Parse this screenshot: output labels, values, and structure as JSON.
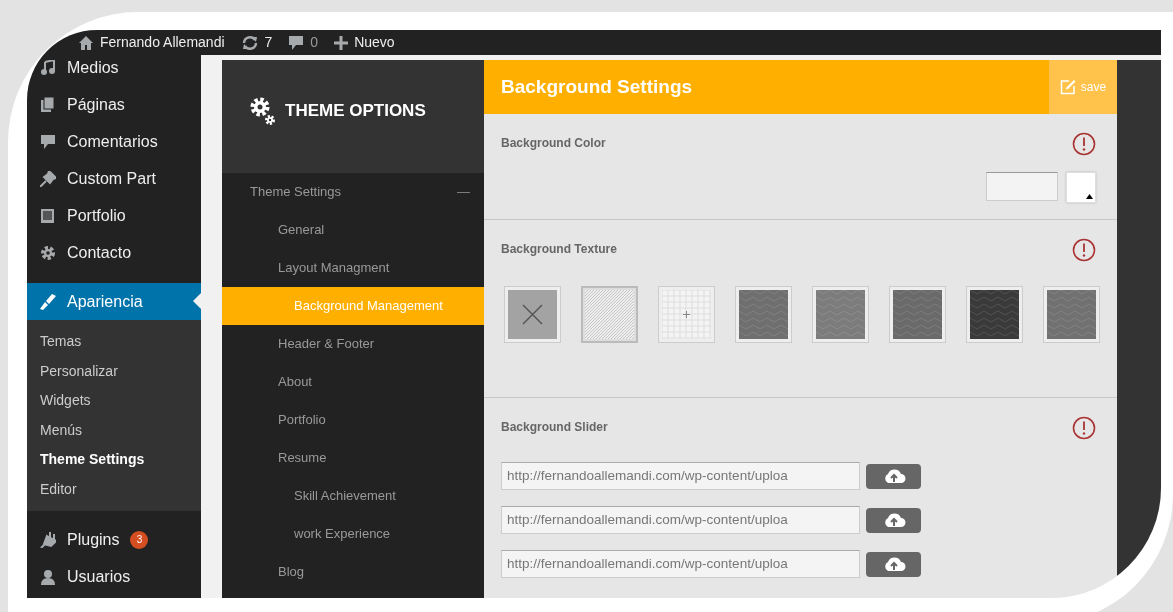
{
  "admin_bar": {
    "site": "Fernando Allemandi",
    "updates": "7",
    "comments": "0",
    "new": "Nuevo"
  },
  "admin_menu": [
    {
      "label": "Medios",
      "selected": false
    },
    {
      "label": "Páginas",
      "selected": false
    },
    {
      "label": "Comentarios",
      "selected": false
    },
    {
      "label": "Custom Part",
      "selected": false
    },
    {
      "label": "Portfolio",
      "selected": false
    },
    {
      "label": "Contacto",
      "selected": false
    },
    {
      "label": "Apariencia",
      "selected": true,
      "submenu": [
        {
          "label": "Temas",
          "selected": false
        },
        {
          "label": "Personalizar",
          "selected": false
        },
        {
          "label": "Widgets",
          "selected": false
        },
        {
          "label": "Menús",
          "selected": false
        },
        {
          "label": "Theme Settings",
          "selected": true
        },
        {
          "label": "Editor",
          "selected": false
        }
      ]
    },
    {
      "label": "Plugins",
      "selected": false,
      "badge": "3"
    },
    {
      "label": "Usuarios",
      "selected": false
    }
  ],
  "theme_panel": {
    "title": "THEME OPTIONS",
    "nav": [
      {
        "label": "Theme Settings",
        "selected": false,
        "expanded": true,
        "toggle": "—",
        "children": [
          {
            "label": "General",
            "selected": false
          },
          {
            "label": "Layout Managment",
            "selected": false
          },
          {
            "label": "Background Management",
            "selected": true
          },
          {
            "label": "Header & Footer",
            "selected": false
          },
          {
            "label": "About",
            "selected": false
          },
          {
            "label": "Portfolio",
            "selected": false
          },
          {
            "label": "Resume",
            "selected": false,
            "children": [
              {
                "label": "Skill Achievement",
                "selected": false
              },
              {
                "label": "work Experience",
                "selected": false
              }
            ]
          },
          {
            "label": "Blog",
            "selected": false
          }
        ]
      }
    ]
  },
  "settings": {
    "title": "Background Settings",
    "save": "save",
    "sections": [
      {
        "kind": "color",
        "label": "Background Color"
      },
      {
        "kind": "texture",
        "label": "Background Texture",
        "textures": [
          {
            "kind": "none",
            "selected": false
          },
          {
            "kind": "diagonal",
            "selected": true
          },
          {
            "kind": "grid",
            "selected": false
          },
          {
            "kind": "pattern",
            "color": "#6f6f6f",
            "selected": false
          },
          {
            "kind": "pattern",
            "color": "#7c7c7c",
            "selected": false
          },
          {
            "kind": "pattern",
            "color": "#6a6a6a",
            "selected": false
          },
          {
            "kind": "pattern",
            "color": "#3a3a3a",
            "selected": false
          },
          {
            "kind": "pattern",
            "color": "#717171",
            "selected": false
          }
        ]
      },
      {
        "kind": "slider",
        "label": "Background Slider",
        "urls": [
          "http://fernandoallemandi.com/wp-content/uploa",
          "http://fernandoallemandi.com/wp-content/uploa",
          "http://fernandoallemandi.com/wp-content/uploa"
        ]
      }
    ]
  }
}
